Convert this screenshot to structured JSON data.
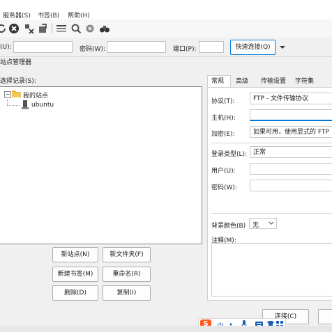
{
  "menu": [
    "服务器(S)",
    "书签(B)",
    "帮助(H)"
  ],
  "quickconnect": {
    "user_label": "(U):",
    "password_label": "密码(W):",
    "port_label": "端口(P):",
    "connect_label": "快速连接(Q)"
  },
  "dialog": {
    "title": "站点管理器",
    "select_entry_label": "选择记录(S):",
    "tree": {
      "root": "我的站点",
      "child": "ubuntu"
    },
    "buttons": {
      "new_site": "新站点(N)",
      "new_folder": "新文件夹(F)",
      "new_bookmark": "新建书签(M)",
      "rename": "重命名(R)",
      "delete": "删除(D)",
      "copy": "复制(I)",
      "connect": "连接(C)"
    },
    "tabs": [
      "常规",
      "高级",
      "传输设置",
      "字符集"
    ],
    "form": {
      "protocol_label": "协议(T):",
      "protocol_value": "FTP - 文件传输协议",
      "host_label": "主机(H):",
      "host_value": "",
      "encryption_label": "加密(E):",
      "encryption_value": "如果可用，使用显式的 FTP",
      "logon_type_label": "登录类型(L):",
      "logon_type_value": "正常",
      "user_label": "用户(U):",
      "password_label": "密码(W):",
      "bg_color_label": "背景颜色(B)",
      "bg_color_value": "无",
      "comments_label": "注释(M):"
    }
  },
  "ime": {
    "mode_label": "中"
  },
  "colors": {
    "accent": "#0078d7",
    "folder": "#e8b640",
    "ime_brand": "#ff5a1f"
  }
}
